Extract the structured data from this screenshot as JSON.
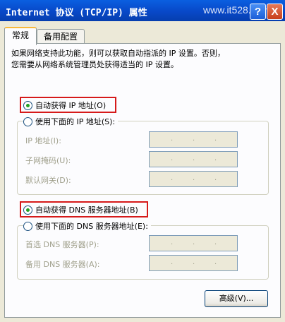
{
  "window": {
    "title": "Internet 协议 (TCP/IP) 属性",
    "watermark": "www.it528.com",
    "help_label": "?",
    "close_label": "X"
  },
  "tabs": [
    {
      "label": "常规",
      "active": true
    },
    {
      "label": "备用配置",
      "active": false
    }
  ],
  "description": {
    "line1": "如果网络支持此功能，则可以获取自动指派的 IP 设置。否则，",
    "line2": "您需要从网络系统管理员处获得适当的 IP 设置。"
  },
  "ip_section": {
    "auto_label": "自动获得 IP 地址(O)",
    "auto_selected": true,
    "manual_label": "使用下面的 IP 地址(S):",
    "manual_selected": false,
    "fields": [
      {
        "label": "IP 地址(I):",
        "value": ""
      },
      {
        "label": "子网掩码(U):",
        "value": ""
      },
      {
        "label": "默认网关(D):",
        "value": ""
      }
    ]
  },
  "dns_section": {
    "auto_label": "自动获得 DNS 服务器地址(B)",
    "auto_selected": true,
    "manual_label": "使用下面的 DNS 服务器地址(E):",
    "manual_selected": false,
    "fields": [
      {
        "label": "首选 DNS 服务器(P):",
        "value": ""
      },
      {
        "label": "备用 DNS 服务器(A):",
        "value": ""
      }
    ]
  },
  "buttons": {
    "advanced_label": "高级(V)..."
  },
  "colors": {
    "titlebar": "#0848C8",
    "highlight_box": "#D61A1A",
    "tab_accent": "#F8B83A",
    "radio_selected": "#21A121"
  }
}
